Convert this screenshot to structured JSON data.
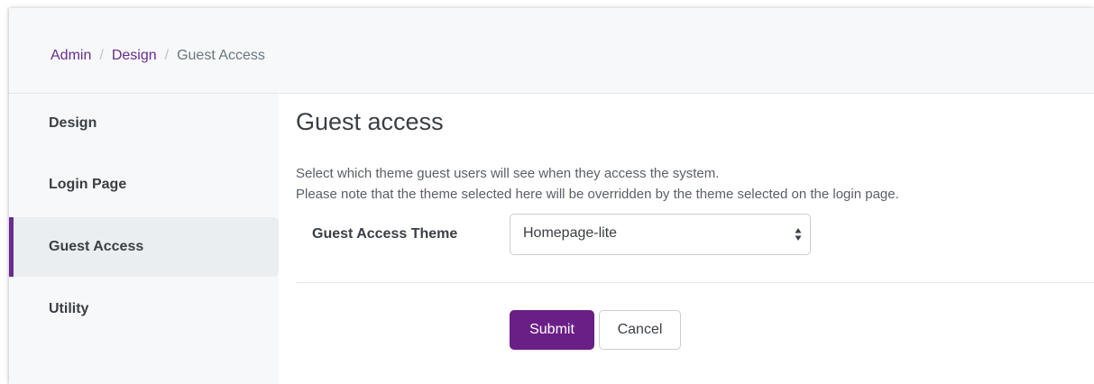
{
  "breadcrumb": {
    "items": [
      {
        "label": "Admin"
      },
      {
        "label": "Design"
      },
      {
        "label": "Guest Access"
      }
    ],
    "separator": "/"
  },
  "sidebar": {
    "items": [
      {
        "label": "Design",
        "active": false
      },
      {
        "label": "Login Page",
        "active": false
      },
      {
        "label": "Guest Access",
        "active": true
      },
      {
        "label": "Utility",
        "active": false
      }
    ]
  },
  "main": {
    "title": "Guest access",
    "description_line1": "Select which theme guest users will see when they access the system.",
    "description_line2": "Please note that the theme selected here will be overridden by the theme selected on the login page.",
    "field_label": "Guest Access Theme",
    "select_value": "Homepage-lite",
    "submit_label": "Submit",
    "cancel_label": "Cancel"
  },
  "colors": {
    "accent": "#6a1f86",
    "link": "#6a2b8e",
    "sidebar_bg": "#f6f8f9",
    "active_item_bg": "#ebeef0"
  }
}
